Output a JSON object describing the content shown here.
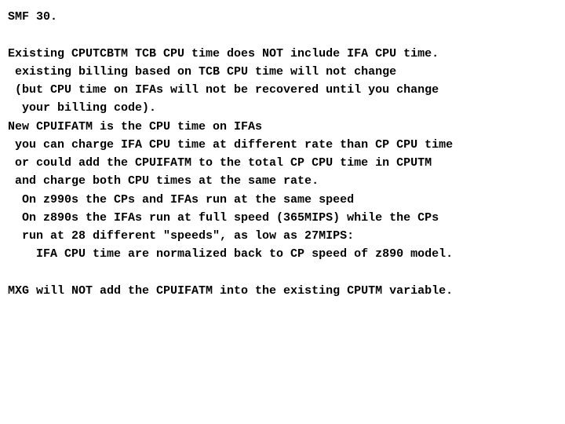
{
  "lines": [
    "SMF 30.",
    "",
    "Existing CPUTCBTM TCB CPU time does NOT include IFA CPU time.",
    " existing billing based on TCB CPU time will not change",
    " (but CPU time on IFAs will not be recovered until you change",
    "  your billing code).",
    "New CPUIFATM is the CPU time on IFAs",
    " you can charge IFA CPU time at different rate than CP CPU time",
    " or could add the CPUIFATM to the total CP CPU time in CPUTM",
    " and charge both CPU times at the same rate.",
    "  On z990s the CPs and IFAs run at the same speed",
    "  On z890s the IFAs run at full speed (365MIPS) while the CPs",
    "  run at 28 different \"speeds\", as low as 27MIPS:",
    "    IFA CPU time are normalized back to CP speed of z890 model.",
    "",
    "MXG will NOT add the CPUIFATM into the existing CPUTM variable."
  ]
}
